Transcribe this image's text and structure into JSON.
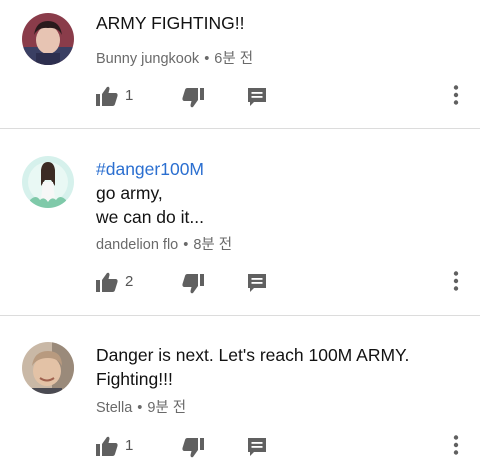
{
  "comments": [
    {
      "text_lines": [
        "ARMY FIGHTING!!"
      ],
      "author": "Bunny jungkook",
      "time": "6분 전",
      "likes": "1"
    },
    {
      "hashtag": "#danger100M",
      "text_lines": [
        "go army,",
        "we can do it..."
      ],
      "author": "dandelion flo",
      "time": "8분 전",
      "likes": "2"
    },
    {
      "text_lines": [
        "Danger is next. Let's reach 100M ARMY.",
        "Fighting!!!"
      ],
      "author": "Stella",
      "time": "9분 전",
      "likes": "1"
    }
  ],
  "separator": "•",
  "icons": {
    "like": "thumbs-up-icon",
    "dislike": "thumbs-down-icon",
    "reply": "reply-comment-icon",
    "more": "more-vert-icon"
  },
  "colors": {
    "hashtag": "#2b6fd0",
    "meta": "#6a6a6a",
    "icon": "#606060",
    "divider": "#dcdcdc"
  }
}
